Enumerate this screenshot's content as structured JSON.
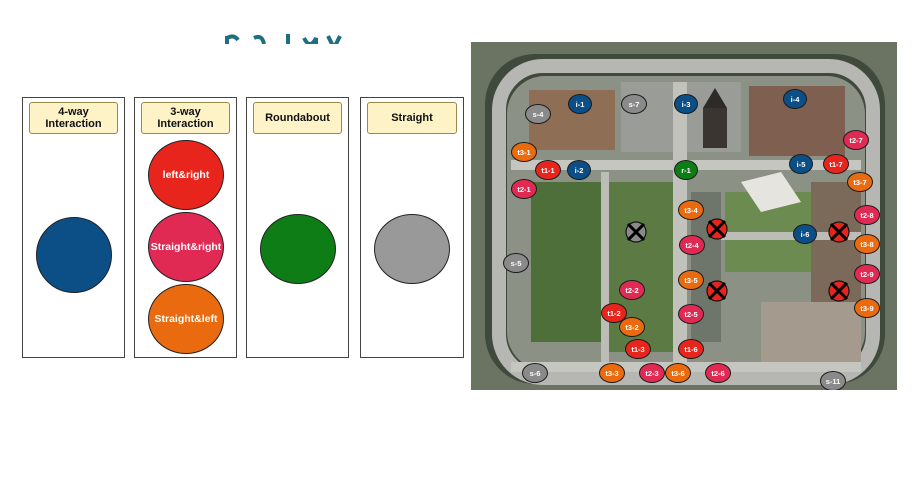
{
  "colors": {
    "four_way": "#0b4f86",
    "left_right": "#e8251c",
    "straight_right": "#e02a54",
    "straight_left": "#ea6a10",
    "roundabout": "#0f7d16",
    "straight": "#999999",
    "header_bg": "#fdf3c7",
    "title_teal": "#1e6f80"
  },
  "legend": {
    "col1": {
      "header_line1": "4-way",
      "header_line2": "Interaction"
    },
    "col2": {
      "header_line1": "3-way",
      "header_line2": "Interaction",
      "dot1_label": "left&right",
      "dot2_label": "Straight&right",
      "dot3_label": "Straight&left"
    },
    "col3": {
      "header": "Roundabout"
    },
    "col4": {
      "header": "Straight"
    }
  },
  "map": {
    "markers": {
      "s4": "s-4",
      "i1": "i-1",
      "s7": "s-7",
      "i3": "i-3",
      "i4": "i-4",
      "t2_7": "t2-7",
      "t3_1": "t3-1",
      "t1_1": "t1-1",
      "i2": "i-2",
      "r1": "r-1",
      "i5": "i-5",
      "t1_7": "t1-7",
      "t3_7": "t3-7",
      "t2_1": "t2-1",
      "t3_4": "t3-4",
      "t2_8": "t2-8",
      "t2_4": "t2-4",
      "i6": "i-6",
      "t3_8": "t3-8",
      "s5": "s-5",
      "t3_5": "t3-5",
      "t2_9": "t2-9",
      "t2_2": "t2-2",
      "t1_2": "t1-2",
      "t2_5": "t2-5",
      "t3_9": "t3-9",
      "t3_2": "t3-2",
      "t1_3": "t1-3",
      "t1_6": "t1-6",
      "s6": "s-6",
      "t3_3": "t3-3",
      "t2_3": "t2-3",
      "t3_6": "t3-6",
      "t2_6": "t2-6",
      "s11": "s-11"
    }
  }
}
